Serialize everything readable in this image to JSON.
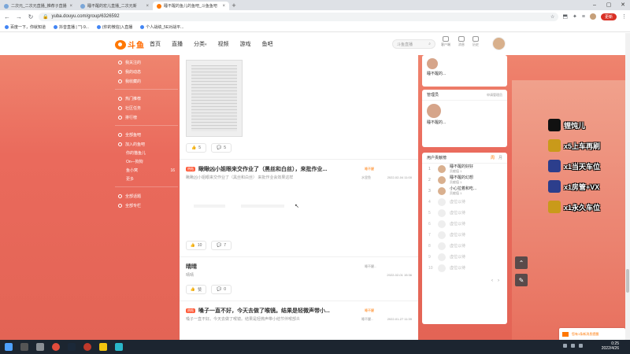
{
  "browser": {
    "tabs": [
      {
        "title": "二次元_二次元直播_推荐子直播",
        "active": false
      },
      {
        "title": "睡不醒的宏儿直播_二次元新",
        "active": false
      },
      {
        "title": "睡不醒的鱼儿的鱼吧_斗鱼鱼吧",
        "active": true
      }
    ],
    "new_tab": "+",
    "url": "yuba.douyu.com/group/6326592",
    "update_label": "更新",
    "bookmarks": [
      "百度一下，你就知道",
      "抖音直播 | \"\"(-9...",
      "(你的微信)入直播",
      "个人战绩_5E对战平..."
    ]
  },
  "header": {
    "logo_text": "斗鱼",
    "menu": [
      "首页",
      "直播",
      "分类",
      "视频",
      "游戏",
      "鱼吧"
    ],
    "search_placeholder": "斗鱼直播",
    "icons": [
      {
        "name": "message-icon",
        "label": "客户端"
      },
      {
        "name": "bell-icon",
        "label": "消息"
      },
      {
        "name": "history-icon",
        "label": "历史"
      }
    ]
  },
  "sidebar": {
    "group1": [
      "我关注的",
      "我的动态",
      "我收藏的"
    ],
    "group2": [
      "热门推荐",
      "社区任务",
      "排行榜"
    ],
    "group3_title": "全部鱼吧",
    "group3_join": "加入的鱼吧",
    "sub_items": [
      {
        "label": "你的猫鱼儿",
        "count": ""
      },
      {
        "label": "On—狗狗",
        "count": ""
      },
      {
        "label": "鱼小窝",
        "count": "16"
      },
      {
        "label": "更多",
        "count": ""
      }
    ],
    "group4": [
      "全部话题",
      "全部专栏"
    ]
  },
  "feed": {
    "post1": {
      "like": "5",
      "comment": "5"
    },
    "post2": {
      "tag": "热帖",
      "title": "瞅瞅凶小姐眼来交作业了（黑丝和白丝），来批作业...",
      "desc": "瞅瞅凶小姐眼来交作业了（黑丝和白丝）  来批作业会效果这样",
      "author_label": "睡不醒",
      "author": "水里鱼",
      "date": "2022-02-04 11:00",
      "like": "10",
      "comment": "7"
    },
    "post3": {
      "title": "晴晴",
      "desc": "晴晴",
      "author": "睡不醒...",
      "date": "2022-02-01 15:36",
      "like": "赞",
      "comment": "0"
    },
    "post4": {
      "tag": "热帖",
      "title": "嗓子一直不好，今天去做了喉镜。结果是轻微声带小...",
      "desc": "嗓子一直不好。今天去做了喉镜。结果是轻微声带小结节伴喉部炎",
      "author_label": "睡不醒",
      "author": "睡不醒...",
      "date": "2022-01-27 11:39"
    }
  },
  "right": {
    "top_user": "睡不醒的...",
    "admin_title": "管理员",
    "admin_more": "申请管理员",
    "admin_name": "睡不醒的...",
    "rank_title": "用户贡献榜",
    "rank_tabs": [
      "周",
      "月"
    ],
    "ranks": [
      {
        "no": "1",
        "name": "睡不醒的好好",
        "sub": "贡献值 1",
        "real": true
      },
      {
        "no": "2",
        "name": "睡不醒的幻想",
        "sub": "贡献值 1",
        "real": true
      },
      {
        "no": "3",
        "name": "小心拉着和吃...",
        "sub": "贡献值 1",
        "real": true
      },
      {
        "no": "4",
        "name": "虚位以待",
        "sub": "",
        "real": false
      },
      {
        "no": "5",
        "name": "虚位以待",
        "sub": "",
        "real": false
      },
      {
        "no": "6",
        "name": "虚位以待",
        "sub": "",
        "real": false
      },
      {
        "no": "7",
        "name": "虚位以待",
        "sub": "",
        "real": false
      },
      {
        "no": "8",
        "name": "虚位以待",
        "sub": "",
        "real": false
      },
      {
        "no": "9",
        "name": "虚位以待",
        "sub": "",
        "real": false
      },
      {
        "no": "10",
        "name": "虚位以待",
        "sub": "",
        "real": false
      }
    ]
  },
  "overlay": [
    {
      "text": "锂饨儿",
      "icon": "tiktok"
    },
    {
      "text": "x5上车再刷",
      "icon": "gold"
    },
    {
      "text": "x1当天车位",
      "icon": "blue"
    },
    {
      "text": "x1房管+VX",
      "icon": "blue"
    },
    {
      "text": "x1永久车位",
      "icon": "gold"
    }
  ],
  "toast": "您有1条新消息提醒",
  "taskbar": {
    "time": "0:25",
    "date": "2022/4/26"
  },
  "colors": {
    "accent": "#ff7700",
    "page_bg": "#ea6a5c",
    "hot_tag": "#ff5b3a"
  }
}
